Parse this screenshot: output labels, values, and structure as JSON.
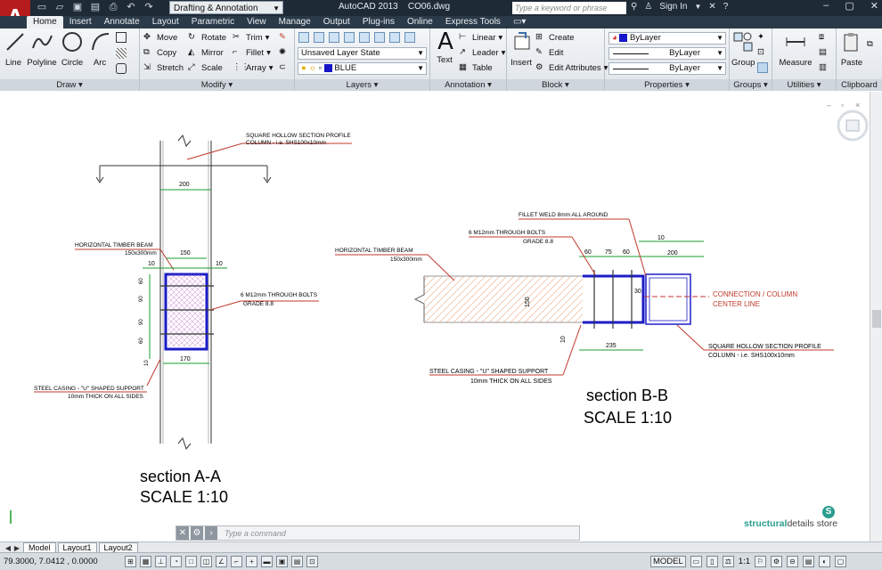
{
  "app": {
    "title": "AutoCAD 2013",
    "filename": "CO06.dwg",
    "workspace": "Drafting & Annotation",
    "search_placeholder": "Type a keyword or phrase",
    "sign_in": "Sign In"
  },
  "ribbon_tabs": [
    "Home",
    "Insert",
    "Annotate",
    "Layout",
    "Parametric",
    "View",
    "Manage",
    "Output",
    "Plug-ins",
    "Online",
    "Express Tools"
  ],
  "panels": {
    "draw": {
      "title": "Draw",
      "line": "Line",
      "polyline": "Polyline",
      "circle": "Circle",
      "arc": "Arc"
    },
    "modify": {
      "title": "Modify",
      "move": "Move",
      "rotate": "Rotate",
      "trim": "Trim",
      "copy": "Copy",
      "mirror": "Mirror",
      "fillet": "Fillet",
      "stretch": "Stretch",
      "scale": "Scale",
      "array": "Array"
    },
    "layers": {
      "title": "Layers",
      "layer_state": "Unsaved Layer State",
      "current_layer": "BLUE"
    },
    "annotation": {
      "title": "Annotation",
      "text": "Text",
      "linear": "Linear",
      "leader": "Leader",
      "table": "Table"
    },
    "block": {
      "title": "Block",
      "insert": "Insert",
      "create": "Create",
      "edit": "Edit",
      "edit_attributes": "Edit Attributes"
    },
    "properties": {
      "title": "Properties",
      "color": "ByLayer",
      "linetype": "ByLayer",
      "lineweight": "ByLayer"
    },
    "groups": {
      "title": "Groups",
      "group": "Group"
    },
    "utilities": {
      "title": "Utilities",
      "measure": "Measure"
    },
    "clipboard": {
      "title": "Clipboard",
      "paste": "Paste"
    }
  },
  "drawing": {
    "section_aa": {
      "title": "section A-A",
      "scale": "SCALE 1:10",
      "shs_label_1": "SQUARE HOLLOW SECTION PROFILE",
      "shs_label_2": "COLUMN - i.e. SHS100x10mm",
      "beam_label_1": "HORIZONTAL TIMBER BEAM",
      "beam_label_2": "150x300mm",
      "bolts_label_1": "6 M12mm THROUGH BOLTS",
      "bolts_label_2": "GRADE 8.8",
      "casing_label_1": "STEEL CASING - \"U\" SHAPED SUPPORT",
      "casing_label_2": "10mm THICK ON ALL SIDES",
      "dim_200": "200",
      "dim_150": "150",
      "dim_10a": "10",
      "dim_10b": "10",
      "dim_170": "170",
      "dim_60a": "60",
      "dim_90a": "90",
      "dim_90b": "90",
      "dim_60b": "60",
      "dim_10c": "10"
    },
    "section_bb": {
      "title": "section B-B",
      "scale": "SCALE 1:10",
      "weld_label": "FILLET WELD 8mm ALL AROUND",
      "bolts_label_1": "6 M12mm THROUGH BOLTS",
      "bolts_label_2": "GRADE 8.8",
      "beam_label_1": "HORIZONTAL TIMBER BEAM",
      "beam_label_2": "150x300mm",
      "connection_1": "CONNECTION / COLUMN",
      "connection_2": "CENTER LINE",
      "shs_label_1": "SQUARE HOLLOW SECTION PROFILE",
      "shs_label_2": "COLUMN - i.e. SHS100x10mm",
      "casing_label_1": "STEEL CASING - \"U\" SHAPED SUPPORT",
      "casing_label_2": "10mm THICK ON ALL SIDES",
      "dim_10": "10",
      "dim_200": "200",
      "dim_60a": "60",
      "dim_75": "75",
      "dim_60b": "60",
      "dim_150": "150",
      "dim_30": "30",
      "dim_235": "235",
      "dim_10b": "10"
    }
  },
  "command": {
    "placeholder": "Type a command"
  },
  "layout_tabs": [
    "Model",
    "Layout1",
    "Layout2"
  ],
  "status": {
    "coords": "79.3000, 7.0412 , 0.0000",
    "model": "MODEL",
    "scale": "1:1"
  },
  "brand": {
    "part1": "structural",
    "part2": "details store",
    "mark": "S"
  }
}
